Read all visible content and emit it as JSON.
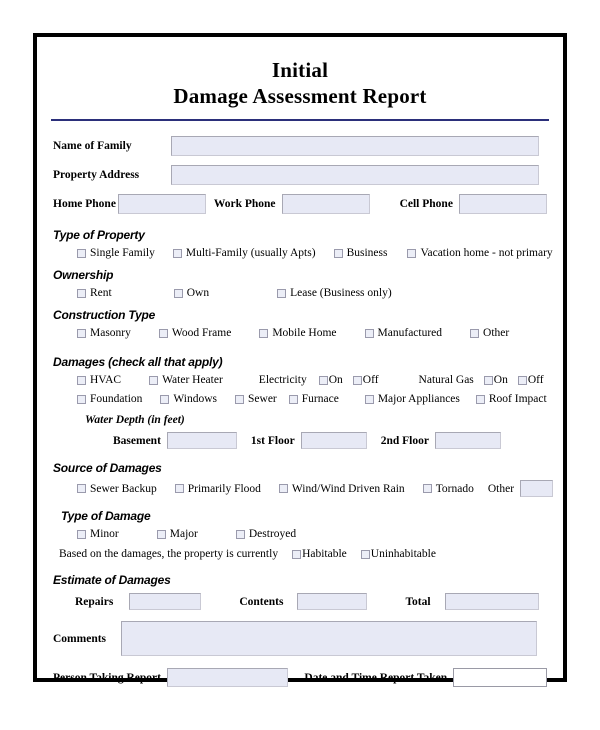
{
  "document": {
    "title_line_1": "Initial",
    "title_line_2": "Damage Assessment Report",
    "rule_color": "#2b2f7a"
  },
  "contact": {
    "name_of_family_label": "Name of Family",
    "name_of_family_value": "",
    "property_address_label": "Property Address",
    "property_address_value": "",
    "home_phone_label": "Home Phone",
    "home_phone_value": "",
    "work_phone_label": "Work Phone",
    "work_phone_value": "",
    "cell_phone_label": "Cell Phone",
    "cell_phone_value": ""
  },
  "type_of_property": {
    "heading": "Type of Property",
    "options": [
      "Single Family",
      "Multi-Family (usually Apts)",
      "Business",
      "Vacation home - not primary"
    ]
  },
  "ownership": {
    "heading": "Ownership",
    "options": [
      "Rent",
      "Own",
      "Lease (Business only)"
    ]
  },
  "construction_type": {
    "heading": "Construction Type",
    "options": [
      "Masonry",
      "Wood Frame",
      "Mobile Home",
      "Manufactured",
      "Other"
    ]
  },
  "damages": {
    "heading": "Damages (check all that apply)",
    "row1": [
      "HVAC",
      "Water Heater"
    ],
    "electricity_label": "Electricity",
    "electricity_on": "On",
    "electricity_off": "Off",
    "natural_gas_label": "Natural Gas",
    "natural_gas_on": "On",
    "natural_gas_off": "Off",
    "row2": [
      "Foundation",
      "Windows",
      "Sewer",
      "Furnace",
      "Major Appliances",
      "Roof Impact"
    ],
    "water_depth_heading": "Water Depth (in feet)",
    "basement_label": "Basement",
    "basement_value": "",
    "first_floor_label": "1st Floor",
    "first_floor_value": "",
    "second_floor_label": "2nd Floor",
    "second_floor_value": ""
  },
  "source_of_damages": {
    "heading": "Source of Damages",
    "options": [
      "Sewer Backup",
      "Primarily Flood",
      "Wind/Wind Driven Rain",
      "Tornado"
    ],
    "other_label": "Other",
    "other_value": ""
  },
  "type_of_damage": {
    "heading": "Type of Damage",
    "options": [
      "Minor",
      "Major",
      "Destroyed"
    ],
    "habitability_question": "Based on the damages, the property is currently",
    "habitable_label": "Habitable",
    "uninhabitable_label": "Uninhabitable"
  },
  "estimate_of_damages": {
    "heading": "Estimate of Damages",
    "repairs_label": "Repairs",
    "repairs_value": "",
    "contents_label": "Contents",
    "contents_value": "",
    "total_label": "Total",
    "total_value": ""
  },
  "footer": {
    "comments_label": "Comments",
    "comments_value": "",
    "person_taking_report_label": "Person Taking Report",
    "person_taking_report_value": "",
    "date_time_label": "Date and Time Report Taken",
    "date_time_value": ""
  }
}
